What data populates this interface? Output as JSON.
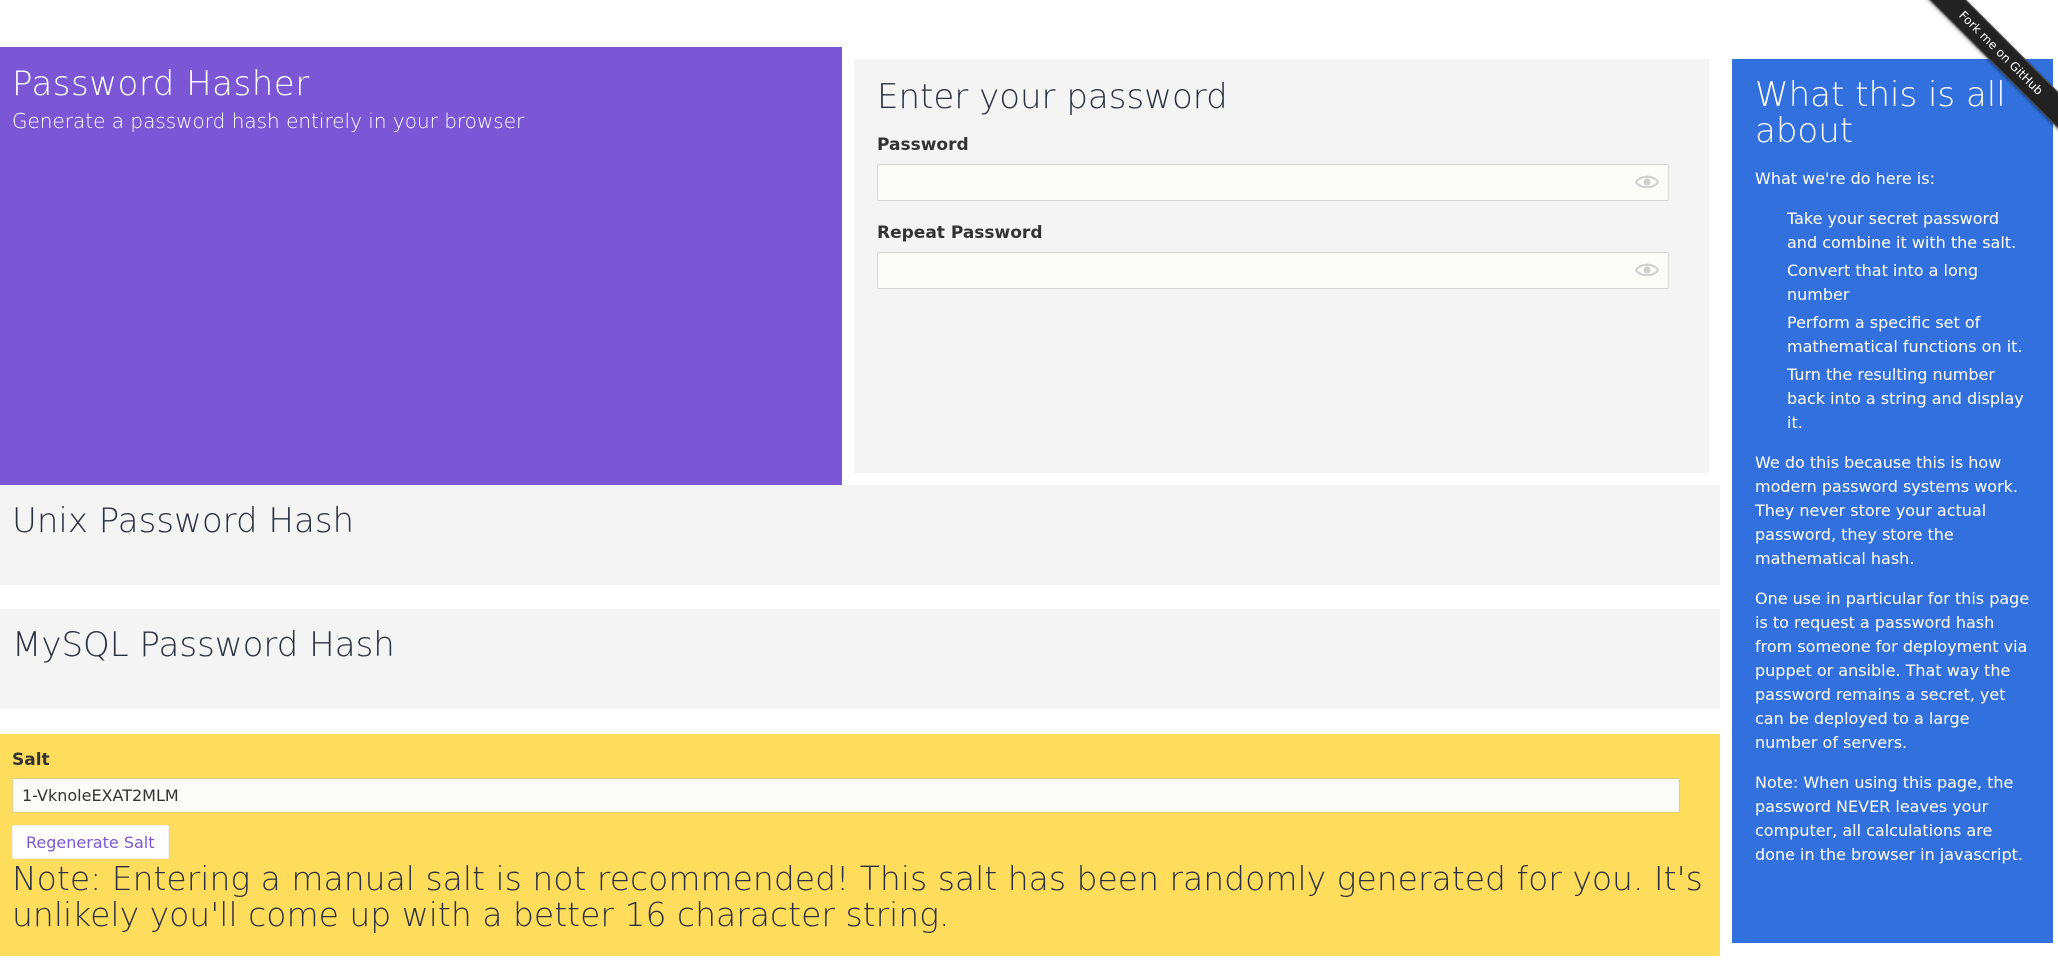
{
  "hero": {
    "title": "Password Hasher",
    "subtitle": "Generate a password hash entirely in your browser"
  },
  "password_panel": {
    "title": "Enter your password",
    "password_label": "Password",
    "repeat_label": "Repeat Password",
    "password_value": "",
    "repeat_value": ""
  },
  "unix": {
    "title": "Unix Password Hash"
  },
  "mysql": {
    "title": "MySQL Password Hash"
  },
  "salt": {
    "label": "Salt",
    "value": "1-VknoleEXAT2MLM",
    "regenerate_label": "Regenerate Salt",
    "note": "Note: Entering a manual salt is not recommended! This salt has been randomly generated for you. It's unlikely you'll come up with a better 16 character string."
  },
  "info": {
    "title": "What this is all about",
    "intro": "What we're do here is:",
    "steps": [
      "Take your secret password and combine it with the salt.",
      "Convert that into a long number",
      "Perform a specific set of mathematical functions on it.",
      "Turn the resulting number back into a string and display it."
    ],
    "para1": "We do this because this is how modern password systems work. They never store your actual password, they store the mathematical hash.",
    "para2": "One use in particular for this page is to request a password hash from someone for deployment via puppet or ansible. That way the password remains a secret, yet can be deployed to a large number of servers.",
    "para3": "Note: When using this page, the password NEVER leaves your computer, all calculations are done in the browser in javascript."
  },
  "ribbon": {
    "label": "Fork me on GitHub"
  },
  "colors": {
    "hero": "#7b57d5",
    "info": "#3170dd",
    "salt": "#ffdd5c",
    "panel": "#f4f4f4"
  },
  "icons": [
    "eye-icon"
  ]
}
